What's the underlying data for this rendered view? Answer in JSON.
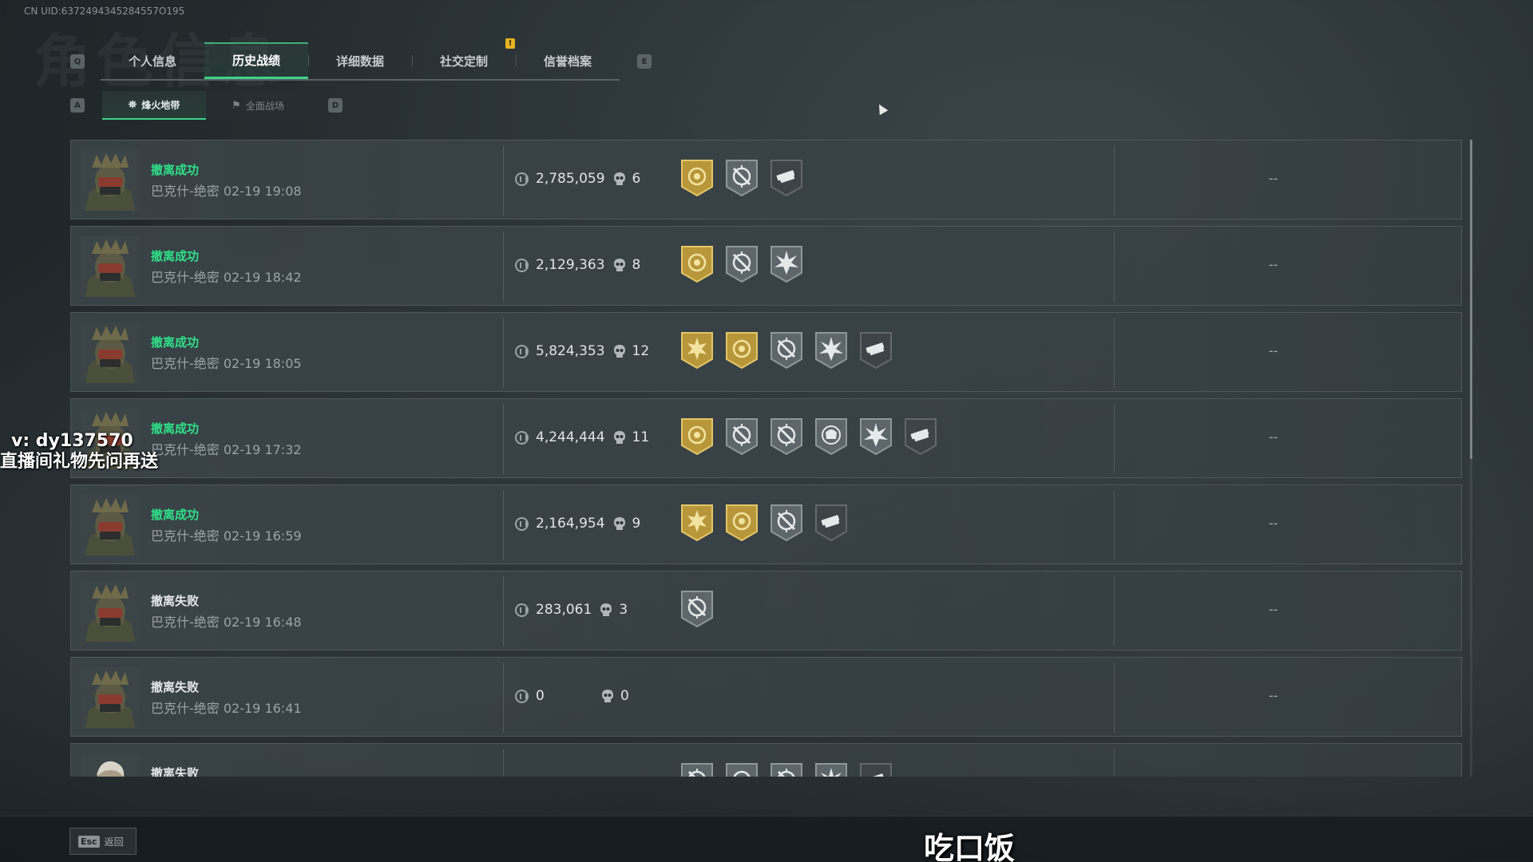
{
  "uid": "CN UID:6372494345284557O195",
  "background_title": "角色信息",
  "keys": {
    "tab_prev": "Q",
    "tab_next": "E",
    "sub_prev": "A",
    "sub_next": "D"
  },
  "main_tabs": [
    {
      "label": "个人信息",
      "active": false
    },
    {
      "label": "历史战绩",
      "active": true
    },
    {
      "label": "详细数据",
      "active": false
    },
    {
      "label": "社交定制",
      "active": false
    },
    {
      "label": "信誉档案",
      "active": false
    }
  ],
  "notice_badge": "!",
  "sub_tabs": [
    {
      "label": "烽火地带",
      "icon": "operations-icon",
      "active": true
    },
    {
      "label": "全面战场",
      "icon": "battlefield-icon",
      "active": false
    }
  ],
  "colors": {
    "success": "#2fe08a",
    "accent": "#3fd08a",
    "gold_badge": "#b8963a",
    "gray_badge": "#5d666a"
  },
  "records": [
    {
      "result": "撤离成功",
      "status": "success",
      "map_time": "巴克什-绝密 02-19 19:08",
      "value": "2,785,059",
      "kills": "6",
      "badges": [
        "gold-seal",
        "gray-crosshair",
        "dark-weapons"
      ],
      "extra": "--"
    },
    {
      "result": "撤离成功",
      "status": "success",
      "map_time": "巴克什-绝密 02-19 18:42",
      "value": "2,129,363",
      "kills": "8",
      "badges": [
        "gold-seal",
        "gray-crosshair",
        "gray-burst"
      ],
      "extra": "--"
    },
    {
      "result": "撤离成功",
      "status": "success",
      "map_time": "巴克什-绝密 02-19 18:05",
      "value": "5,824,353",
      "kills": "12",
      "badges": [
        "gold-sun",
        "gold-seal",
        "gray-crosshair",
        "gray-burst",
        "dark-weapons"
      ],
      "extra": "--"
    },
    {
      "result": "撤离成功",
      "status": "success",
      "map_time": "巴克什-绝密 02-19 17:32",
      "value": "4,244,444",
      "kills": "11",
      "badges": [
        "gold-seal",
        "gray-crosshair",
        "gray-crosshair",
        "gray-skull",
        "gray-burst",
        "dark-weapons"
      ],
      "extra": "--"
    },
    {
      "result": "撤离成功",
      "status": "success",
      "map_time": "巴克什-绝密 02-19 16:59",
      "value": "2,164,954",
      "kills": "9",
      "badges": [
        "gold-sun",
        "gold-seal",
        "gray-crosshair",
        "dark-weapons"
      ],
      "extra": "--"
    },
    {
      "result": "撤离失败",
      "status": "fail",
      "map_time": "巴克什-绝密 02-19 16:48",
      "value": "283,061",
      "kills": "3",
      "badges": [
        "gray-crosshair"
      ],
      "extra": "--"
    },
    {
      "result": "撤离失败",
      "status": "fail",
      "map_time": "巴克什-绝密 02-19 16:41",
      "value": "0",
      "kills": "0",
      "badges": [],
      "extra": "--"
    },
    {
      "result": "撤离失败",
      "status": "fail",
      "map_time": "",
      "value": "",
      "kills": "",
      "badges": [
        "gray-crosshair",
        "gray-seal",
        "gray-crosshair",
        "gray-burst",
        "dark-weapons"
      ],
      "extra": ""
    }
  ],
  "watermark": {
    "line1": "v: dy137570",
    "line2": "直播间礼物先问再送"
  },
  "footer": {
    "esc_key": "Esc",
    "back_label": "返回"
  },
  "subtitle": "吃口饭"
}
